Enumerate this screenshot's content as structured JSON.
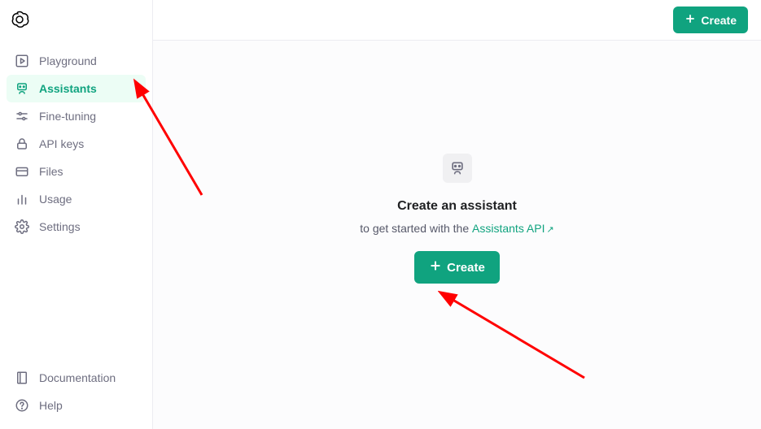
{
  "colors": {
    "accent": "#10a37f"
  },
  "sidebar": {
    "items": [
      {
        "label": "Playground"
      },
      {
        "label": "Assistants"
      },
      {
        "label": "Fine-tuning"
      },
      {
        "label": "API keys"
      },
      {
        "label": "Files"
      },
      {
        "label": "Usage"
      },
      {
        "label": "Settings"
      }
    ],
    "footer": [
      {
        "label": "Documentation"
      },
      {
        "label": "Help"
      }
    ]
  },
  "topbar": {
    "create_label": "Create"
  },
  "empty_state": {
    "title": "Create an assistant",
    "subtitle_prefix": "to get started with the ",
    "link_text": "Assistants API",
    "button_label": "Create"
  }
}
